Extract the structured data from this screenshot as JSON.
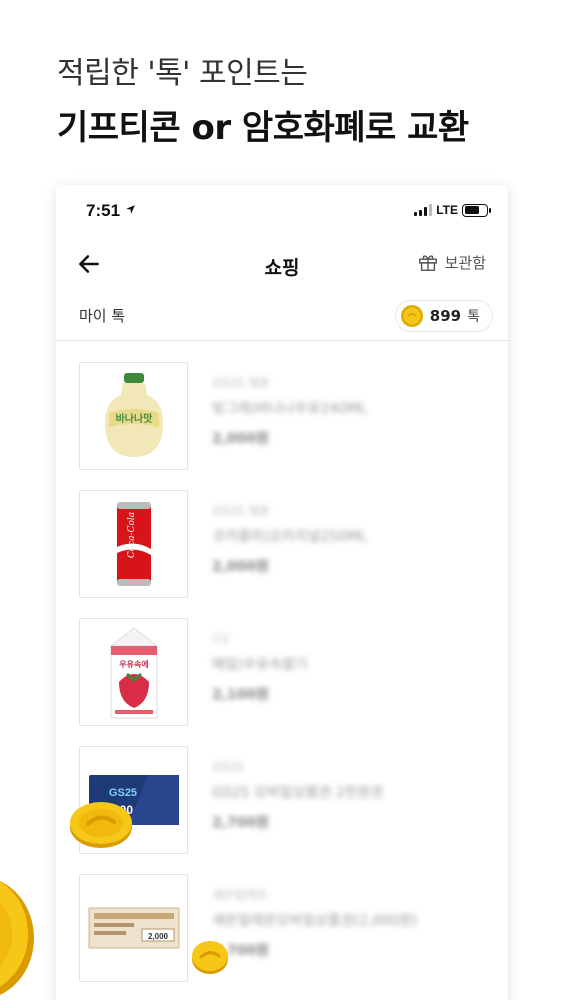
{
  "headline": {
    "line1": "적립한 '톡' 포인트는",
    "line2": "기프티콘 or 암호화폐로 교환"
  },
  "status_bar": {
    "time": "7:51",
    "network": "LTE"
  },
  "nav": {
    "title": "쇼핑",
    "storage_label": "보관함"
  },
  "mytok": {
    "label": "마이 톡",
    "amount": "899",
    "unit": "톡"
  },
  "products": [
    {
      "brand": "GS25 제휴",
      "name": "빙그레)바나나우유240ML",
      "price": "2,000원",
      "thumb": "banana-milk"
    },
    {
      "brand": "GS25 제휴",
      "name": "코카콜라)오리지널250ML",
      "price": "2,000원",
      "thumb": "coke-can"
    },
    {
      "brand": "CU",
      "name": "매일)우유속딸기",
      "price": "2,100원",
      "thumb": "strawberry-milk"
    },
    {
      "brand": "GS25",
      "name": "GS25 모바일상품권 2천원권",
      "price": "2,700원",
      "thumb": "gift-card"
    },
    {
      "brand": "세븐일레븐",
      "name": "세븐일레븐모바일상품권(2,000원)",
      "price": "2,700원",
      "thumb": "voucher"
    }
  ],
  "colors": {
    "coin": "#F5C518",
    "coin_dark": "#E0A800"
  }
}
